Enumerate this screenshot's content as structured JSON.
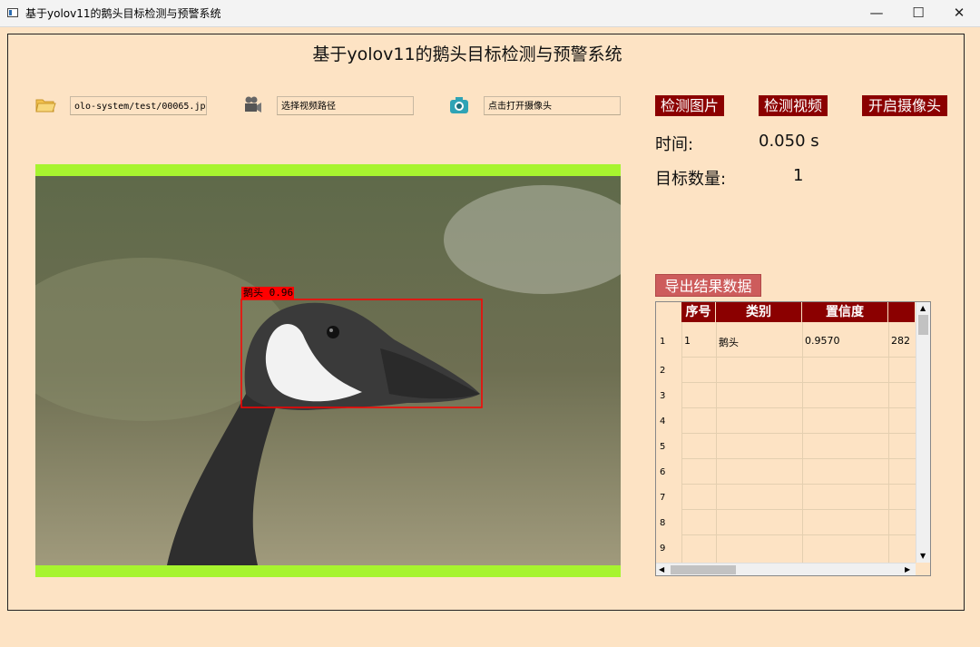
{
  "window": {
    "title": "基于yolov11的鹅头目标检测与预警系统",
    "minimize": "—",
    "maximize": "☐",
    "close": "✕"
  },
  "app": {
    "title": "基于yolov11的鹅头目标检测与预警系统"
  },
  "inputs": {
    "image_path": "olo-system/test/00065.jpg",
    "video_path": "选择视频路径",
    "camera": "点击打开摄像头"
  },
  "buttons": {
    "detect_image": "检测图片",
    "detect_video": "检测视频",
    "open_camera": "开启摄像头",
    "export": "导出结果数据"
  },
  "info": {
    "time_label": "时间:",
    "time_value": "0.050 s",
    "count_label": "目标数量:",
    "count_value": "1"
  },
  "detection": {
    "label": "鹅头 0.96"
  },
  "table": {
    "headers": [
      "序号",
      "类别",
      "置信度",
      ""
    ],
    "row_numbers": [
      "1",
      "2",
      "3",
      "4",
      "5",
      "6",
      "7",
      "8",
      "9"
    ],
    "rows": [
      {
        "index": "1",
        "class": "鹅头",
        "confidence": "0.9570",
        "coords": "282"
      }
    ]
  },
  "colors": {
    "background": "#fde3c4",
    "button_red": "#8b0000",
    "export_button": "#cd5c5c",
    "video_border": "#a7f42f",
    "bbox": "#ff0000"
  },
  "icons": {
    "image_path": "folder-icon",
    "video_path": "video-camera-icon",
    "camera": "camera-icon"
  }
}
